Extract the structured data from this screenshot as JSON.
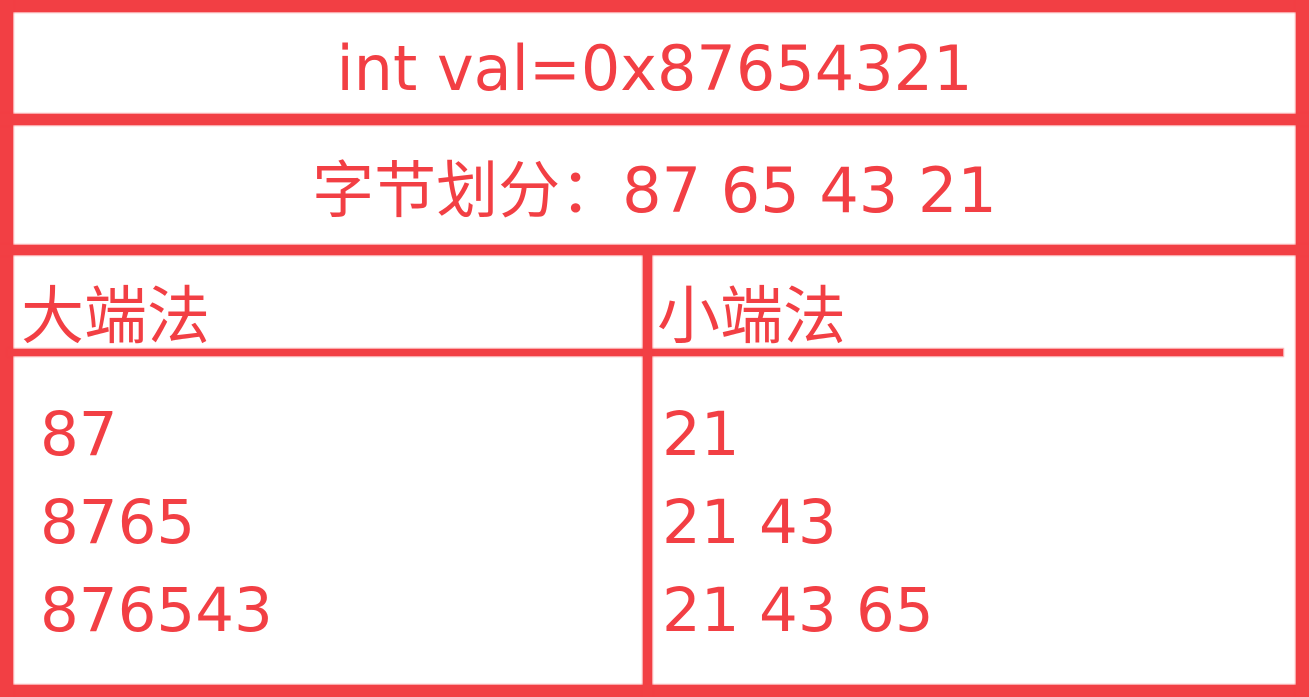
{
  "diagram": {
    "title": "int val=0x87654321",
    "byte_division": "字节划分：87 65 43 21",
    "big_endian": {
      "label": "大端法",
      "rows": [
        "87",
        "8765",
        "876543"
      ]
    },
    "little_endian": {
      "label": "小端法",
      "rows": [
        "21",
        "21 43",
        "21 43 65"
      ]
    },
    "color": "#f23f44"
  }
}
